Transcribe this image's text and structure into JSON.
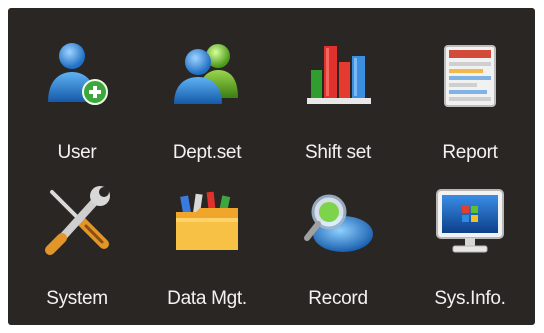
{
  "menu": {
    "items": [
      {
        "label": "User",
        "icon": "user-add-icon"
      },
      {
        "label": "Dept.set",
        "icon": "users-group-icon"
      },
      {
        "label": "Shift set",
        "icon": "bar-chart-icon"
      },
      {
        "label": "Report",
        "icon": "report-icon"
      },
      {
        "label": "System",
        "icon": "wrench-screwdriver-icon"
      },
      {
        "label": "Data Mgt.",
        "icon": "folder-tools-icon"
      },
      {
        "label": "Record",
        "icon": "magnifier-record-icon"
      },
      {
        "label": "Sys.Info.",
        "icon": "monitor-icon"
      }
    ]
  },
  "colors": {
    "background": "#2a2624",
    "label": "#f2f2f2"
  }
}
